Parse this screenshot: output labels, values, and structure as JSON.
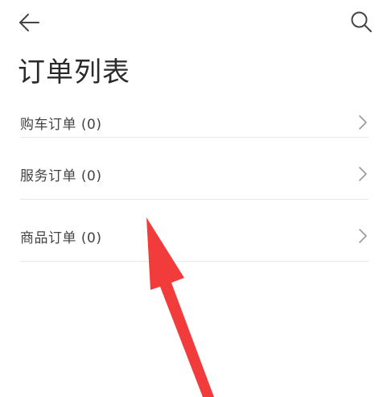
{
  "header": {
    "back_icon": "arrow-left-icon",
    "search_icon": "search-icon"
  },
  "page": {
    "title": "订单列表"
  },
  "orders": [
    {
      "label": "购车订单 (0)",
      "icon": "chevron-right-icon"
    },
    {
      "label": "服务订单 (0)",
      "icon": "chevron-right-icon"
    },
    {
      "label": "商品订单 (0)",
      "icon": "chevron-right-icon"
    }
  ],
  "annotation": {
    "type": "red-arrow",
    "color": "#f23c3c"
  }
}
